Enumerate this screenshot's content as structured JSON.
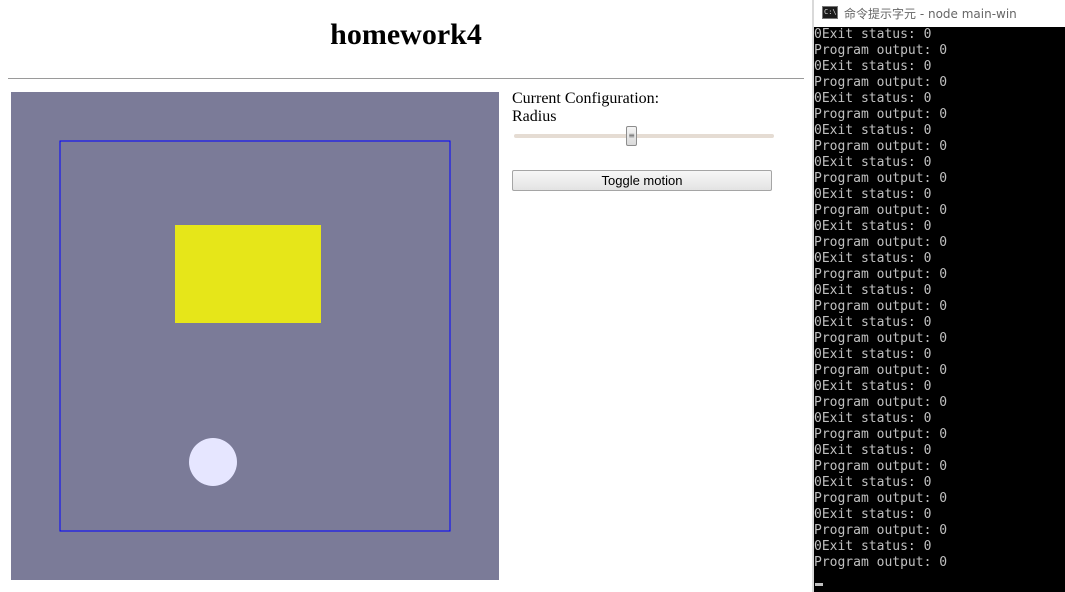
{
  "browser": {
    "page_title": "homework4",
    "config": {
      "heading": "Current Configuration:",
      "parameter_label": "Radius",
      "slider_value_fraction": 0.45
    },
    "toggle_button_label": "Toggle motion"
  },
  "canvas": {
    "background_color": "#7b7b98",
    "boundary_color": "#0000ff",
    "rectangle_color": "#e6e619",
    "circle_color": "#e6e6ff"
  },
  "console": {
    "window_title": "命令提示字元 - node  main-win",
    "icon": "cmd-icon",
    "lines": [
      "0Exit status: 0",
      "Program output: 0",
      "0Exit status: 0",
      "Program output: 0",
      "0Exit status: 0",
      "Program output: 0",
      "0Exit status: 0",
      "Program output: 0",
      "0Exit status: 0",
      "Program output: 0",
      "0Exit status: 0",
      "Program output: 0",
      "0Exit status: 0",
      "Program output: 0",
      "0Exit status: 0",
      "Program output: 0",
      "0Exit status: 0",
      "Program output: 0",
      "0Exit status: 0",
      "Program output: 0",
      "0Exit status: 0",
      "Program output: 0",
      "0Exit status: 0",
      "Program output: 0",
      "0Exit status: 0",
      "Program output: 0",
      "0Exit status: 0",
      "Program output: 0",
      "0Exit status: 0",
      "Program output: 0",
      "0Exit status: 0",
      "Program output: 0",
      "0Exit status: 0",
      "Program output: 0"
    ]
  }
}
